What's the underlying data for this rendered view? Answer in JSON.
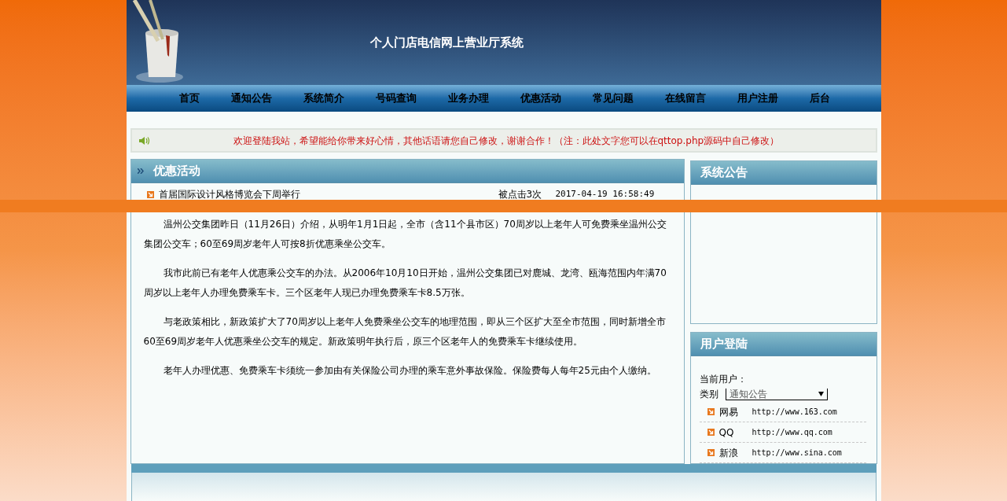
{
  "header": {
    "title": "个人门店电信网上营业厅系统"
  },
  "nav": [
    "首页",
    "通知公告",
    "系统简介",
    "号码查询",
    "业务办理",
    "优惠活动",
    "常见问题",
    "在线留言",
    "用户注册",
    "后台"
  ],
  "marquee": {
    "text": "欢迎登陆我站，希望能给你带来好心情，其他话语请您自己修改，谢谢合作！（注：此处文字您可以在qttop.php源码中自己修改）"
  },
  "promotions": {
    "title": "优惠活动",
    "items": [
      {
        "title": "首届国际设计风格博览会下周举行",
        "clicks": "被点击3次",
        "date": "2017-04-19 16:58:49"
      }
    ],
    "article": [
      "温州公交集团昨日（11月26日）介绍，从明年1月1日起，全市（含11个县市区）70周岁以上老年人可免费乘坐温州公交集团公交车；60至69周岁老年人可按8折优惠乘坐公交车。",
      "我市此前已有老年人优惠乘公交车的办法。从2006年10月10日开始，温州公交集团已对鹿城、龙湾、瓯海范围内年满70周岁以上老年人办理免费乘车卡。三个区老年人现已办理免费乘车卡8.5万张。",
      "与老政策相比，新政策扩大了70周岁以上老年人免费乘坐公交车的地理范围，即从三个区扩大至全市范围，同时新增全市60至69周岁老年人优惠乘坐公交车的规定。新政策明年执行后，原三个区老年人的免费乘车卡继续使用。",
      "老年人办理优惠、免费乘车卡须统一参加由有关保险公司办理的乘车意外事故保险。保险费每人每年25元由个人缴纳。"
    ]
  },
  "announcements": {
    "title": "系统公告"
  },
  "login": {
    "title": "用户登陆",
    "current_user_label": "当前用户：",
    "category_label": "类别",
    "category_value": "通知公告",
    "links": [
      {
        "name": "网易",
        "url": "http://www.163.com"
      },
      {
        "name": "QQ",
        "url": "http://www.qq.com"
      },
      {
        "name": "新浪",
        "url": "http://www.sina.com"
      }
    ]
  }
}
